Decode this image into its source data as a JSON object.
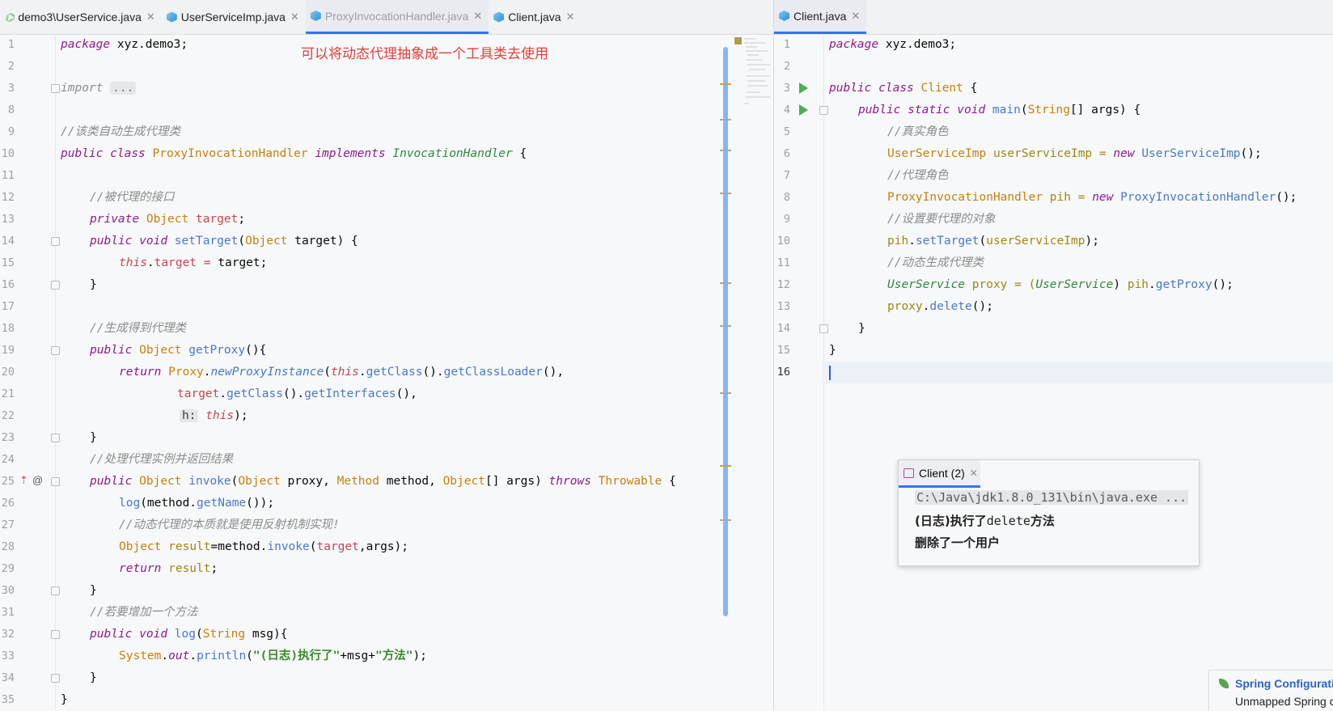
{
  "left_tabs": [
    {
      "label": "demo3\\UserService.java",
      "icon": "interface-icon",
      "active": false
    },
    {
      "label": "UserServiceImp.java",
      "icon": "java-class-icon",
      "active": false
    },
    {
      "label": "ProxyInvocationHandler.java",
      "icon": "java-class-icon",
      "active": true
    },
    {
      "label": "Client.java",
      "icon": "java-class-icon",
      "active": false
    }
  ],
  "right_tabs": [
    {
      "label": "Client.java",
      "icon": "java-class-icon",
      "active": true
    }
  ],
  "annotation_note": "可以将动态代理抽象成一个工具类去使用",
  "left_lines": [
    {
      "n": "1"
    },
    {
      "n": "2"
    },
    {
      "n": "3"
    },
    {
      "n": "8"
    },
    {
      "n": "9"
    },
    {
      "n": "10"
    },
    {
      "n": "11"
    },
    {
      "n": "12"
    },
    {
      "n": "13"
    },
    {
      "n": "14"
    },
    {
      "n": "15"
    },
    {
      "n": "16"
    },
    {
      "n": "17"
    },
    {
      "n": "18"
    },
    {
      "n": "19"
    },
    {
      "n": "20"
    },
    {
      "n": "21"
    },
    {
      "n": "22"
    },
    {
      "n": "23"
    },
    {
      "n": "24"
    },
    {
      "n": "25"
    },
    {
      "n": "26"
    },
    {
      "n": "27"
    },
    {
      "n": "28"
    },
    {
      "n": "29"
    },
    {
      "n": "30"
    },
    {
      "n": "31"
    },
    {
      "n": "32"
    },
    {
      "n": "33"
    },
    {
      "n": "34"
    },
    {
      "n": "35"
    }
  ],
  "left_code": {
    "l1_pkg_kw": "package",
    "l1_pkg_name": " xyz.demo3;",
    "l3_import_kw": "import",
    "l3_fold": "...",
    "l9_comment": "//该类自动生成代理类",
    "l10_public": "public",
    "l10_class": "class",
    "l10_name": "ProxyInvocationHandler",
    "l10_implements": "implements",
    "l10_iface": "InvocationHandler",
    "l10_brace": " {",
    "l12_comment": "//被代理的接口",
    "l13_private": "private",
    "l13_type": "Object",
    "l13_field": "target",
    "l13_semi": ";",
    "l14_public": "public",
    "l14_void": "void",
    "l14_method": "setTarget",
    "l14_rest1": "(",
    "l14_type": "Object",
    "l14_rest2": " target) {",
    "l15_this": "this",
    "l15_dot": ".",
    "l15_field": "target",
    "l15_eq": " = ",
    "l15_rest": "target;",
    "l16_brace": "}",
    "l18_comment": "//生成得到代理类",
    "l19_public": "public",
    "l19_type": "Object",
    "l19_method": "getProxy",
    "l19_rest": "(){",
    "l20_return": "return",
    "l20_proxy": "Proxy",
    "l20_dot": ".",
    "l20_newproxy": "newProxyInstance",
    "l20_p1": "(",
    "l20_this": "this",
    "l20_p2": ".",
    "l20_getclass": "getClass",
    "l20_p3": "().",
    "l20_getcl": "getClassLoader",
    "l20_p4": "(),",
    "l21_target": "target",
    "l21_p1": ".",
    "l21_getclass": "getClass",
    "l21_p2": "().",
    "l21_getif": "getInterfaces",
    "l21_p3": "(),",
    "l22_hint": "h:",
    "l22_this": "this",
    "l22_rest": ");",
    "l23_brace": "}",
    "l24_comment": "//处理代理实例并返回结果",
    "l25_public": "public",
    "l25_type": "Object",
    "l25_method": "invoke",
    "l25_p1": "(",
    "l25_t1": "Object",
    "l25_a1": " proxy, ",
    "l25_t2": "Method",
    "l25_a2": " method, ",
    "l25_t3": "Object",
    "l25_a3": "[] args) ",
    "l25_throws": "throws",
    "l25_throwable": "Throwable",
    "l25_brace": " {",
    "l26_log": "log",
    "l26_p1": "(method.",
    "l26_getname": "getName",
    "l26_p2": "());",
    "l27_comment": "//动态代理的本质就是使用反射机制实现!",
    "l28_type": "Object",
    "l28_var": "result",
    "l28_p1": "=method.",
    "l28_invoke": "invoke",
    "l28_p2": "(",
    "l28_target": "target",
    "l28_p3": ",args);",
    "l29_return": "return",
    "l29_var": " result",
    "l29_semi": ";",
    "l30_brace": "}",
    "l31_comment": "//若要增加一个方法",
    "l32_public": "public",
    "l32_void": "void",
    "l32_method": "log",
    "l32_p1": "(",
    "l32_type": "String",
    "l32_p2": " msg){",
    "l33_system": "System",
    "l33_dot": ".",
    "l33_out": "out",
    "l33_dot2": ".",
    "l33_println": "println",
    "l33_p1": "(",
    "l33_str1": "\"(日志)执行了\"",
    "l33_p2": "+msg+",
    "l33_str2": "\"方法\"",
    "l33_p3": ");",
    "l34_brace": "}",
    "l35_brace": "}"
  },
  "right_lines": [
    {
      "n": "1"
    },
    {
      "n": "2"
    },
    {
      "n": "3"
    },
    {
      "n": "4"
    },
    {
      "n": "5"
    },
    {
      "n": "6"
    },
    {
      "n": "7"
    },
    {
      "n": "8"
    },
    {
      "n": "9"
    },
    {
      "n": "10"
    },
    {
      "n": "11"
    },
    {
      "n": "12"
    },
    {
      "n": "13"
    },
    {
      "n": "14"
    },
    {
      "n": "15"
    },
    {
      "n": "16"
    }
  ],
  "right_code": {
    "r1_pkg_kw": "package",
    "r1_pkg_name": " xyz.demo3;",
    "r3_public": "public",
    "r3_class": "class",
    "r3_name": "Client",
    "r3_brace": " {",
    "r4_public": "public",
    "r4_static": "static",
    "r4_void": "void",
    "r4_method": "main",
    "r4_p1": "(",
    "r4_type": "String",
    "r4_p2": "[] args) {",
    "r5_comment": "//真实角色",
    "r6_type": "UserServiceImp",
    "r6_var": " userServiceImp",
    "r6_eq": " = ",
    "r6_new": "new",
    "r6_ctor": "UserServiceImp",
    "r6_rest": "();",
    "r7_comment": "//代理角色",
    "r8_type": "ProxyInvocationHandler",
    "r8_var": " pih",
    "r8_eq": " = ",
    "r8_new": "new",
    "r8_ctor": "ProxyInvocationHandler",
    "r8_rest": "();",
    "r9_comment": "//设置要代理的对象",
    "r10_var": "pih",
    "r10_dot": ".",
    "r10_method": "setTarget",
    "r10_p1": "(",
    "r10_arg": "userServiceImp",
    "r10_p2": ");",
    "r11_comment": "//动态生成代理类",
    "r12_type": "UserService",
    "r12_var": " proxy",
    "r12_eq": " = (",
    "r12_cast": "UserService",
    "r12_p1": ") ",
    "r12_pih": "pih",
    "r12_dot": ".",
    "r12_method": "getProxy",
    "r12_p2": "();",
    "r13_var": "proxy",
    "r13_dot": ".",
    "r13_method": "delete",
    "r13_p": "();",
    "r14_brace": "}",
    "r15_brace": "}"
  },
  "run_popup": {
    "tab_label": "Client (2)",
    "cmd_line": "C:\\Java\\jdk1.8.0_131\\bin\\java.exe ...",
    "out1_a": "(日志)执行了",
    "out1_b": "delete",
    "out1_c": "方法",
    "out2": "删除了一个用户"
  },
  "spring_notice": {
    "title": "Spring Configurati",
    "body": "Unmapped Spring c"
  },
  "colors": {
    "keyword": "#0033b3",
    "class": "#c7800a",
    "comment": "#8c8c8c",
    "string": "#3b8a2c",
    "accent": "#3574f0",
    "annotation_note": "#e0403a"
  }
}
